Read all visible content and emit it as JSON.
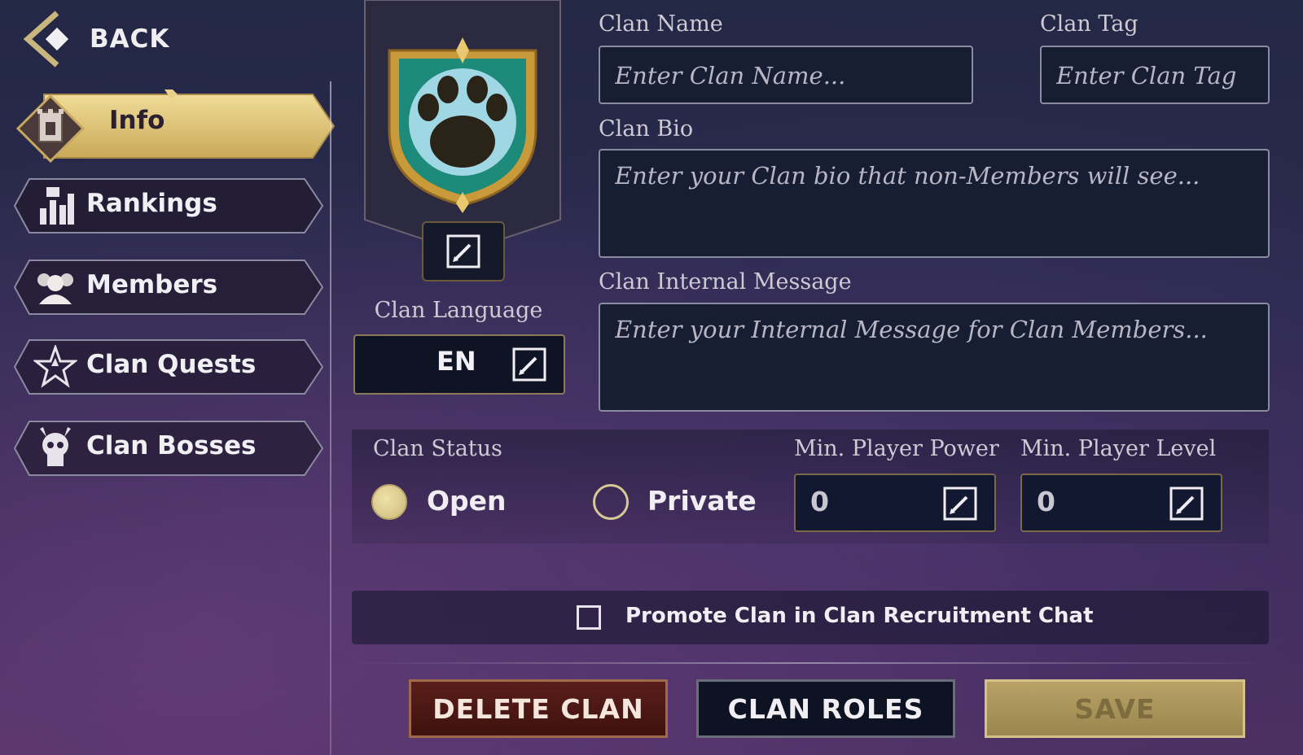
{
  "nav": {
    "back_label": "BACK",
    "items": [
      {
        "label": "Info",
        "icon": "castle-tower-icon",
        "active": true
      },
      {
        "label": "Rankings",
        "icon": "rankings-chart-icon",
        "active": false
      },
      {
        "label": "Members",
        "icon": "members-group-icon",
        "active": false
      },
      {
        "label": "Clan Quests",
        "icon": "star-icon",
        "active": false
      },
      {
        "label": "Clan Bosses",
        "icon": "skull-icon",
        "active": false
      }
    ]
  },
  "emblem": {
    "icon": "paw-shield-icon"
  },
  "language": {
    "label": "Clan Language",
    "value": "EN"
  },
  "form": {
    "name_label": "Clan Name",
    "name_placeholder": "Enter Clan Name...",
    "tag_label": "Clan Tag",
    "tag_placeholder": "Enter Clan Tag",
    "bio_label": "Clan Bio",
    "bio_placeholder": "Enter your Clan bio that non-Members will see...",
    "internal_label": "Clan Internal Message",
    "internal_placeholder": "Enter your Internal Message for Clan Members..."
  },
  "status": {
    "label": "Clan Status",
    "options": [
      {
        "label": "Open",
        "selected": true
      },
      {
        "label": "Private",
        "selected": false
      }
    ],
    "min_power_label": "Min. Player Power",
    "min_power_value": "0",
    "min_level_label": "Min. Player Level",
    "min_level_value": "0"
  },
  "promote": {
    "label": "Promote Clan in Clan Recruitment Chat",
    "checked": false
  },
  "buttons": {
    "delete": "DELETE CLAN",
    "roles": "CLAN ROLES",
    "save": "SAVE"
  },
  "colors": {
    "gold": "#d9c07a",
    "panel": "#171d33",
    "delete": "#5a1e1a"
  }
}
